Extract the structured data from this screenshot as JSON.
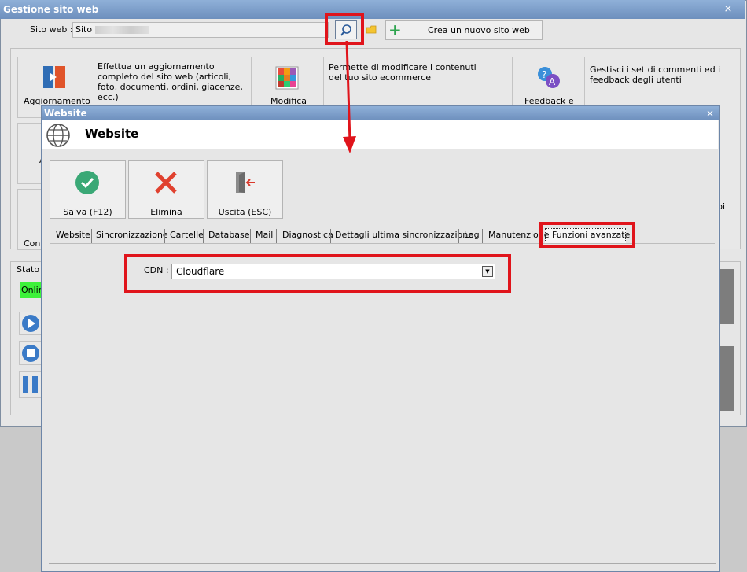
{
  "main_window": {
    "title": "Gestione sito web",
    "close_glyph": "×",
    "site_label": "Sito web :",
    "site_value": "Sito",
    "new_site_label": "Crea un nuovo sito web",
    "tiles": {
      "aggiornamento": {
        "label": "Aggiornamento",
        "description": "Effettua un aggiornamento completo del sito web (articoli, foto, documenti, ordini, giacenze, ecc.)"
      },
      "modifica": {
        "label": "Modifica",
        "description": "Permette di modificare i contenuti del tuo sito ecommerce"
      },
      "feedback": {
        "label": "Feedback e",
        "description": "Gestisci i set di commenti ed i feedback degli utenti"
      },
      "left2_fragment": "A",
      "left3_fragment": "Conf"
    },
    "status_label": "Stato",
    "status_value": "Onlin",
    "right_fragment": "pi"
  },
  "modal": {
    "title": "Website",
    "close_glyph": "×",
    "heading": "Website",
    "toolbar": {
      "save_label": "Salva (F12)",
      "delete_label": "Elimina",
      "exit_label": "Uscita (ESC)"
    },
    "tabs": [
      "Website",
      "Sincronizzazione",
      "Cartelle",
      "Database",
      "Mail",
      "Diagnostica",
      "Dettagli ultima sincronizzazione",
      "Log",
      "Manutenzione",
      "Funzioni avanzate"
    ],
    "active_tab": "Funzioni avanzate",
    "cdn_label": "CDN :",
    "cdn_value": "Cloudflare"
  },
  "colors": {
    "highlight": "#e0141b",
    "titlebar": "#7a9cc9",
    "online": "#3df23a"
  }
}
